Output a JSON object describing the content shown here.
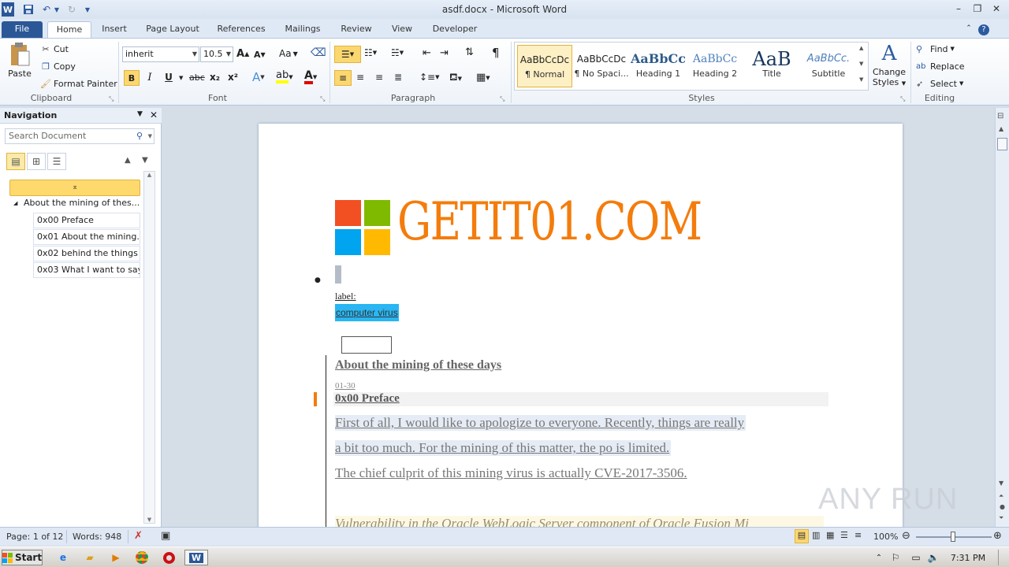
{
  "window": {
    "title": "asdf.docx - Microsoft Word",
    "app_icon": "W",
    "controls": {
      "minimize": "–",
      "restore": "❐",
      "close": "✕"
    }
  },
  "ribbon_tabs": [
    "File",
    "Home",
    "Insert",
    "Page Layout",
    "References",
    "Mailings",
    "Review",
    "View",
    "Developer"
  ],
  "clipboard": {
    "paste": "Paste",
    "cut": "Cut",
    "copy": "Copy",
    "format_painter": "Format Painter",
    "label": "Clipboard"
  },
  "font": {
    "name": "inherit",
    "size": "10.5",
    "label": "Font",
    "bold": "B",
    "italic": "I",
    "underline": "U",
    "strike": "abc",
    "sub": "x₂",
    "sup": "x²",
    "grow": "A",
    "shrink": "A",
    "case": "Aa",
    "color": "A"
  },
  "paragraph": {
    "label": "Paragraph",
    "pilcrow": "¶"
  },
  "styles": {
    "label": "Styles",
    "items": [
      {
        "sample": "AaBbCcDc",
        "name": "¶ Normal"
      },
      {
        "sample": "AaBbCcDc",
        "name": "¶ No Spaci..."
      },
      {
        "sample": "AaBbCc",
        "name": "Heading 1"
      },
      {
        "sample": "AaBbCc",
        "name": "Heading 2"
      },
      {
        "sample": "AaB",
        "name": "Title"
      },
      {
        "sample": "AaBbCc.",
        "name": "Subtitle"
      }
    ],
    "change_line1": "Change",
    "change_line2": "Styles"
  },
  "editing": {
    "label": "Editing",
    "find": "Find",
    "replace": "Replace",
    "select": "Select"
  },
  "navigation": {
    "title": "Navigation",
    "search_placeholder": "Search Document",
    "items": [
      "About the mining of thes...",
      "0x00 Preface",
      "0x01 About the mining...",
      "0x02 behind the things",
      "0x03 What I want to say"
    ]
  },
  "document": {
    "logo_text": "GETIT01.COM",
    "label_text": "label:",
    "tag_text": "computer virus",
    "heading": "About the mining of these days",
    "date": "01-30",
    "section_title": "0x00 Preface",
    "para1_line1": "First of all, I would like to apologize to everyone. Recently, things are really",
    "para1_line2": "a bit too much. For the mining of this matter, the po is limited.",
    "para2": "The chief culprit of this mining virus is actually CVE-2017-3506.",
    "para3": "Vulnerability in the Oracle WebLogic Server component of Oracle Fusion Mi",
    "colors": {
      "logo_orange": "#f47c0c",
      "tag_bg": "#29b6f2",
      "ms_red": "#f25022",
      "ms_green": "#7fba00",
      "ms_blue": "#00a4ef",
      "ms_yellow": "#ffb900"
    }
  },
  "status": {
    "page": "Page: 1 of 12",
    "words": "Words: 948",
    "zoom": "100%"
  },
  "taskbar": {
    "start": "Start",
    "time": "7:31 PM"
  },
  "watermark": "ANY RUN"
}
